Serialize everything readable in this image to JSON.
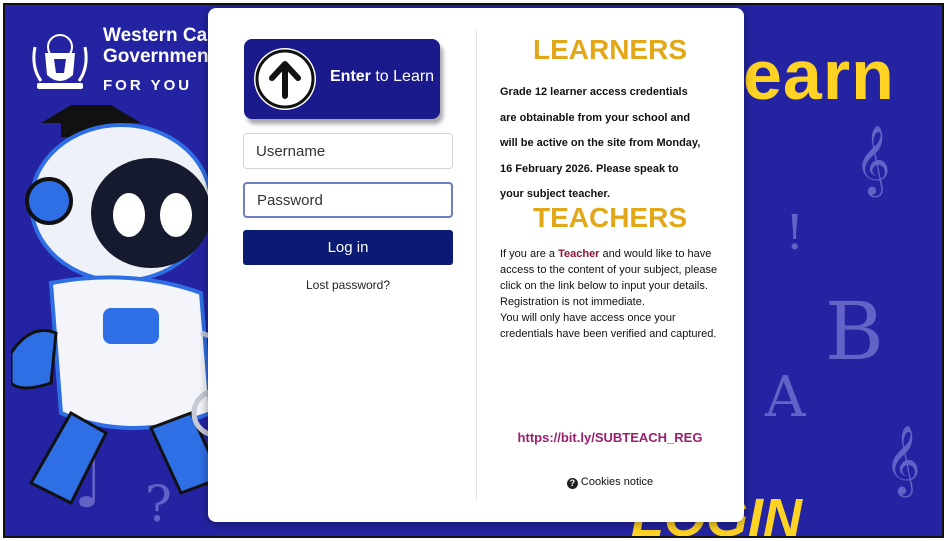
{
  "branding": {
    "gov_line1": "Western Ca",
    "gov_line2": "Governmen",
    "gov_line3_a": "FOR ",
    "gov_line3_b": "YOU",
    "hero_word": "earn",
    "hero_bottom": "LOGIN",
    "background_color": "#2424a3",
    "accent_color": "#ffd324"
  },
  "login": {
    "enter_bold": "Enter",
    "enter_rest": " to Learn",
    "username_placeholder": "Username",
    "password_placeholder": "Password",
    "login_label": "Log in",
    "lost_password": "Lost password?",
    "button_color": "#0b1a73"
  },
  "learners": {
    "heading": "LEARNERS",
    "lines": [
      "Grade 12 learner access credentials",
      "are obtainable from your school and",
      "will be active on the site from Monday,",
      "16 February 2026. Please speak to",
      "your subject teacher."
    ]
  },
  "teachers": {
    "heading": "TEACHERS",
    "p1_pre": "If you are a ",
    "p1_highlight": "Teacher",
    "p1_post": " and would like to have access to the content of your subject, please click on the link below to input your details. Registration is not immediate.",
    "p2": "You will only have access once your credentials have been verified and captured.",
    "link": "https://bit.ly/SUBTEACH_REG"
  },
  "footer": {
    "cookies": "Cookies notice",
    "cookies_icon": "question-circle-icon"
  },
  "icons": {
    "enter": "arrow-up-circle-icon",
    "crest": "coat-of-arms-icon",
    "robot": "robot-mascot-illustration"
  }
}
